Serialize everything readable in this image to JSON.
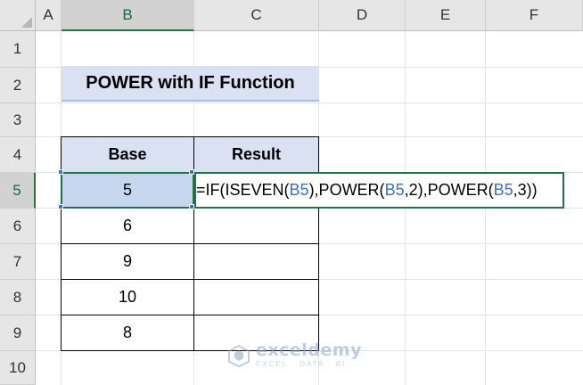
{
  "columns": [
    "A",
    "B",
    "C",
    "D",
    "E",
    "F"
  ],
  "rows": [
    "1",
    "2",
    "3",
    "4",
    "5",
    "6",
    "7",
    "8",
    "9",
    "10"
  ],
  "selected_cell": "B5",
  "title": "POWER with IF Function",
  "table": {
    "headers": [
      "Base",
      "Result"
    ],
    "base_values": [
      "5",
      "6",
      "9",
      "10",
      "8"
    ]
  },
  "formula": {
    "p1": "=IF(ISEVEN(",
    "ref1": "B5",
    "p2": "),POWER(",
    "ref2": "B5",
    "p3": ",2),POWER(",
    "ref3": "B5",
    "p4": ",3))"
  },
  "watermark": {
    "name": "exceldemy",
    "tagline": "EXCEL · DATA · BI"
  },
  "colors": {
    "accent_green": "#217346",
    "header_fill": "#d9e1f2",
    "ref_blue": "#3a6fc4",
    "ref_red": "#d32f2f"
  }
}
